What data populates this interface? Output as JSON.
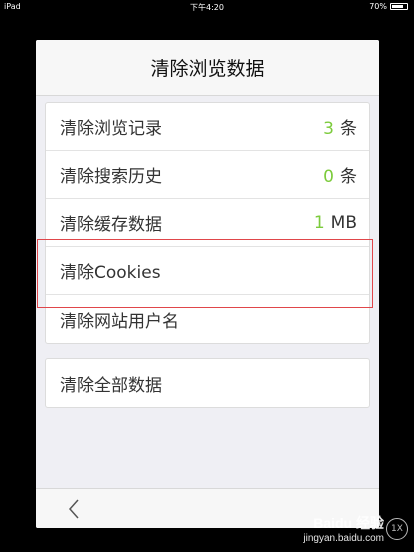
{
  "statusbar": {
    "device": "iPad",
    "time": "下午4:20",
    "battery": "70%",
    "battery_level": 0.7
  },
  "title": "清除浏览数据",
  "group1": [
    {
      "label": "清除浏览记录",
      "count": "3",
      "unit": "条"
    },
    {
      "label": "清除搜索历史",
      "count": "0",
      "unit": "条"
    },
    {
      "label": "清除缓存数据",
      "count": "1",
      "unit": "MB"
    },
    {
      "label": "清除Cookies"
    },
    {
      "label": "清除网站用户名"
    }
  ],
  "group2": [
    {
      "label": "清除全部数据"
    }
  ],
  "watermark": {
    "line1": "Baidu 经验",
    "line2": "jingyan.baidu.com"
  },
  "zoom_badge": "1X",
  "colors": {
    "accent": "#7ccb3c",
    "highlight": "#e0464a"
  }
}
